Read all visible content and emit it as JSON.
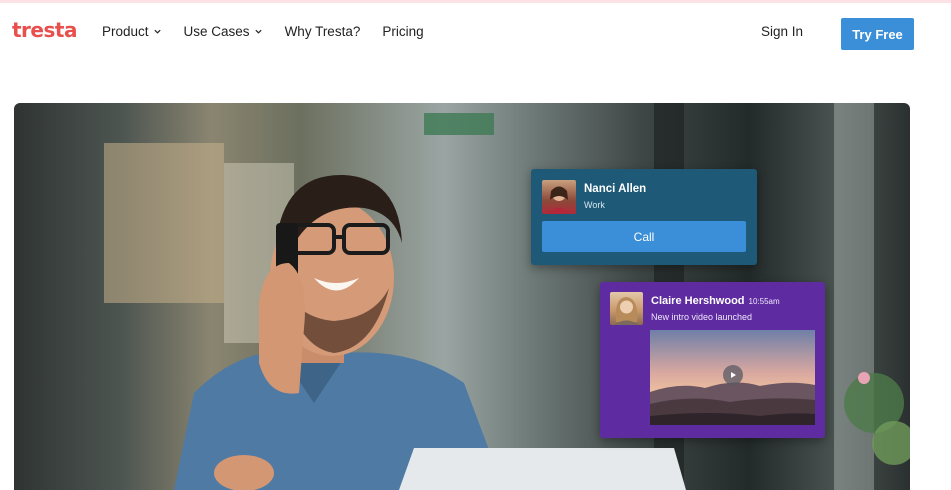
{
  "brand": {
    "logo": "tresta",
    "logo_color": "#e8504d"
  },
  "nav": {
    "items": [
      {
        "label": "Product",
        "dropdown": true
      },
      {
        "label": "Use Cases",
        "dropdown": true
      },
      {
        "label": "Why Tresta?",
        "dropdown": false
      },
      {
        "label": "Pricing",
        "dropdown": false
      }
    ],
    "sign_in": "Sign In",
    "try_free": "Try Free"
  },
  "hero": {
    "call_card": {
      "name": "Nanci Allen",
      "label": "Work",
      "button": "Call",
      "bg": "#1e5a78"
    },
    "message_card": {
      "name": "Claire Hershwood",
      "time": "10:55am",
      "message": "New intro video launched",
      "bg": "#5e2ca0"
    }
  },
  "colors": {
    "accent": "#3a8fd8"
  }
}
